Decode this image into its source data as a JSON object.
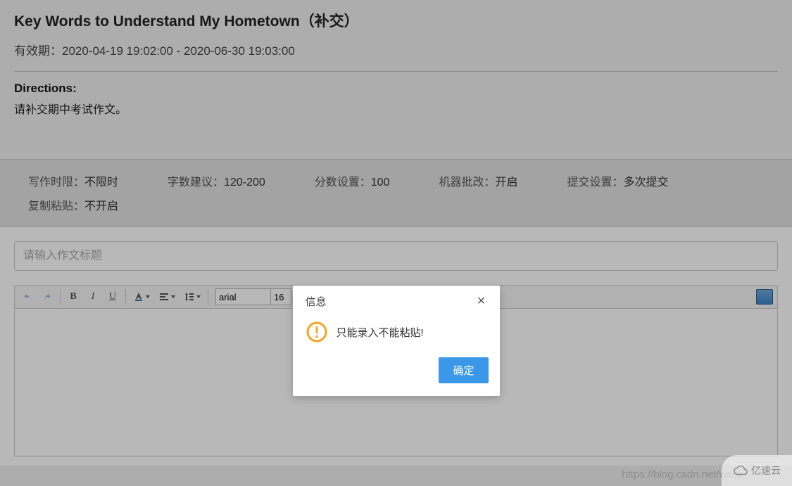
{
  "assignment": {
    "title": "Key Words to Understand My Hometown（补交）",
    "validity_label": "有效期：",
    "validity_value": "2020-04-19 19:02:00 - 2020-06-30 19:03:00",
    "directions_label": "Directions:",
    "directions_body": "请补交期中考试作文。"
  },
  "settings": {
    "row1": [
      {
        "label": "写作时限：",
        "value": "不限时"
      },
      {
        "label": "字数建议：",
        "value": "120-200"
      },
      {
        "label": "分数设置：",
        "value": "100"
      },
      {
        "label": "机器批改：",
        "value": "开启"
      },
      {
        "label": "提交设置：",
        "value": "多次提交"
      }
    ],
    "row2": [
      {
        "label": "复制粘贴：",
        "value": "不开启"
      }
    ]
  },
  "editor": {
    "title_placeholder": "请输入作文标题",
    "font_family": "arial",
    "font_size": "16",
    "icons": {
      "undo": "undo-icon",
      "redo": "redo-icon",
      "bold": "B",
      "italic": "I",
      "underline": "U",
      "text_color": "text-color-icon",
      "align": "align-icon",
      "line_height": "line-height-icon",
      "fullscreen": "fullscreen-icon"
    }
  },
  "modal": {
    "title": "信息",
    "message": "只能录入不能粘贴!",
    "ok": "确定",
    "icon": "warning-icon",
    "close_icon": "close-icon"
  },
  "watermark": {
    "url_text": "https://blog.csdn.net/weixi",
    "badge_text": "亿速云",
    "badge_icon": "cloud-icon"
  },
  "colors": {
    "primary_button": "#3b97e8",
    "warning_ring": "#f5a623"
  }
}
